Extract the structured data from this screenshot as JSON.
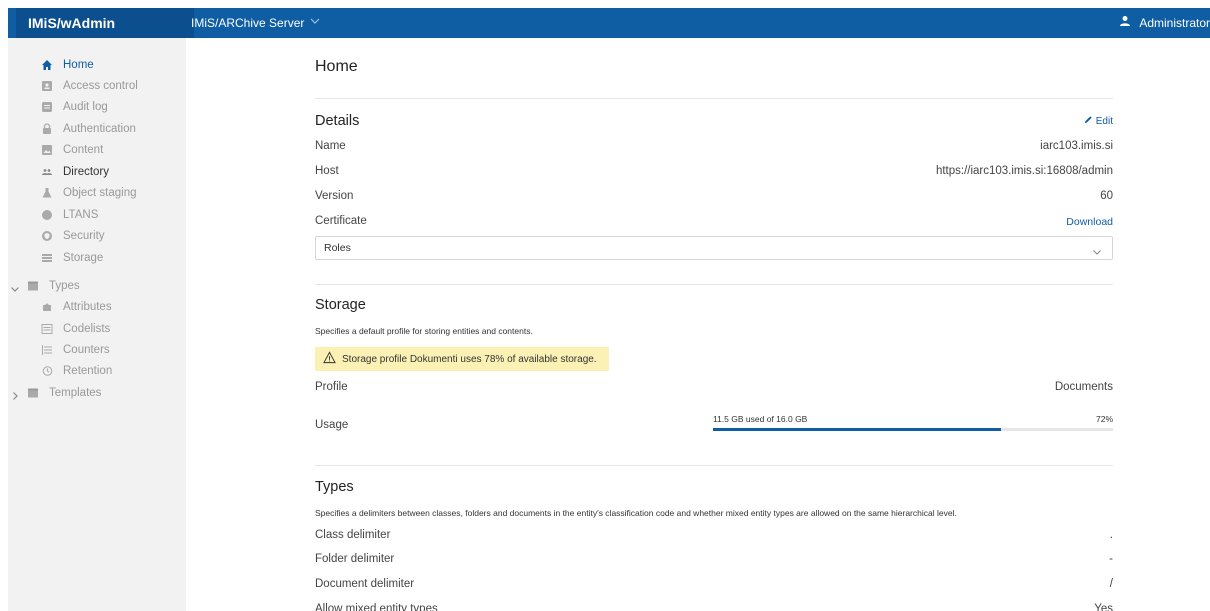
{
  "topbar": {
    "brand": "IMiS/wAdmin",
    "server": "IMiS/ARChive Server",
    "user": "Administrator"
  },
  "sidebar": {
    "items": [
      {
        "label": "Home",
        "icon": "home-icon"
      },
      {
        "label": "Access control",
        "icon": "id-card-icon"
      },
      {
        "label": "Audit log",
        "icon": "log-icon"
      },
      {
        "label": "Authentication",
        "icon": "lock-icon"
      },
      {
        "label": "Content",
        "icon": "image-icon"
      },
      {
        "label": "Directory",
        "icon": "users-icon"
      },
      {
        "label": "Object staging",
        "icon": "flask-icon"
      },
      {
        "label": "LTANS",
        "icon": "circle-icon"
      },
      {
        "label": "Security",
        "icon": "shield-icon"
      },
      {
        "label": "Storage",
        "icon": "storage-icon"
      },
      {
        "label": "Types",
        "icon": "folder-icon"
      },
      {
        "label": "Attributes",
        "icon": "puzzle-icon"
      },
      {
        "label": "Codelists",
        "icon": "list-icon"
      },
      {
        "label": "Counters",
        "icon": "counter-icon"
      },
      {
        "label": "Retention",
        "icon": "history-icon"
      },
      {
        "label": "Templates",
        "icon": "folder-icon"
      }
    ]
  },
  "main": {
    "title": "Home",
    "details": {
      "title": "Details",
      "edit": "Edit",
      "rows": [
        {
          "label": "Name",
          "value": "iarc103.imis.si"
        },
        {
          "label": "Host",
          "value": "https://iarc103.imis.si:16808/admin"
        },
        {
          "label": "Version",
          "value": "60"
        },
        {
          "label": "Certificate",
          "value": "Download"
        }
      ],
      "roles": "Roles"
    },
    "storage": {
      "title": "Storage",
      "description": "Specifies a default profile for storing entities and contents.",
      "warning": "Storage profile Dokumenti uses 78% of available storage.",
      "profile_label": "Profile",
      "profile_value": "Documents",
      "usage_label": "Usage",
      "usage_text": "11.5 GB used of 16.0 GB",
      "usage_percent": "72%",
      "usage_fraction": 0.72
    },
    "types": {
      "title": "Types",
      "description": "Specifies a delimiters between classes, folders and documents in the entity's classification code and whether mixed entity types are allowed on the same hierarchical level.",
      "rows": [
        {
          "label": "Class delimiter",
          "value": "."
        },
        {
          "label": "Folder delimiter",
          "value": "-"
        },
        {
          "label": "Document delimiter",
          "value": "/"
        },
        {
          "label": "Allow mixed entity types",
          "value": "Yes"
        }
      ]
    }
  },
  "colors": {
    "accent": "#0f5da3",
    "warning_bg": "#fbf1b4"
  }
}
